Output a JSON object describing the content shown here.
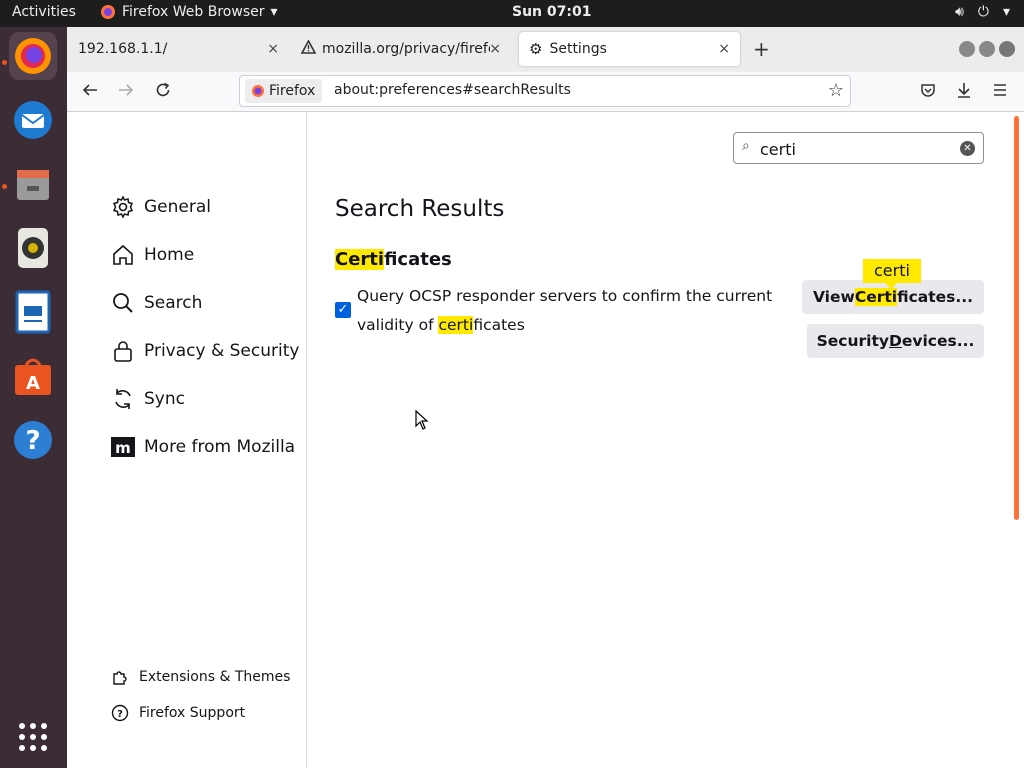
{
  "topbar": {
    "activities": "Activities",
    "app_name": "Firefox Web Browser",
    "clock": "Sun 07:01",
    "tray_icons": [
      "volume-icon",
      "power-icon",
      "chevron-down-icon"
    ]
  },
  "dock": {
    "items": [
      "firefox-icon",
      "thunderbird-icon",
      "files-icon",
      "rhythmbox-icon",
      "writer-icon",
      "software-icon",
      "help-icon",
      "app-grid-icon"
    ]
  },
  "tabs": [
    {
      "title": "192.168.1.1/",
      "close": "×"
    },
    {
      "title": "mozilla.org/privacy/firefc",
      "close": "×"
    },
    {
      "title": "Settings",
      "close": "×"
    }
  ],
  "new_tab": "+",
  "navbar": {
    "identity": "Firefox",
    "url": "about:preferences#searchResults"
  },
  "sidebar": {
    "categories": [
      {
        "label": "General",
        "icon": "gear-icon"
      },
      {
        "label": "Home",
        "icon": "home-icon"
      },
      {
        "label": "Search",
        "icon": "search-icon"
      },
      {
        "label": "Privacy & Security",
        "icon": "lock-icon"
      },
      {
        "label": "Sync",
        "icon": "sync-icon"
      },
      {
        "label": "More from Mozilla",
        "icon": "mozilla-icon"
      }
    ],
    "footer": [
      {
        "label": "Extensions & Themes",
        "icon": "puzzle-icon"
      },
      {
        "label": "Firefox Support",
        "icon": "help-circle-icon"
      }
    ]
  },
  "main": {
    "search_value": "certi",
    "heading": "Search Results",
    "section": {
      "highlight": "Certi",
      "rest": "ficates"
    },
    "ocsp": {
      "line1": "Query OCSP responder servers to confirm the current",
      "prefix": "validity of ",
      "highlight": "certi",
      "suffix": "ficates",
      "checked": true
    },
    "tooltip": "certi",
    "buttons": {
      "view_cert": {
        "pre": "View ",
        "hl": "Certi",
        "post": "ficates..."
      },
      "security_devices": {
        "pre": "Security ",
        "u": "D",
        "post": "evices..."
      }
    }
  },
  "colors": {
    "highlight": "#ffe900",
    "checkbox": "#0061e0",
    "dock_bg": "#3b2c35",
    "topbar_bg": "#1d1d1d",
    "accent_orange": "#e95420"
  }
}
